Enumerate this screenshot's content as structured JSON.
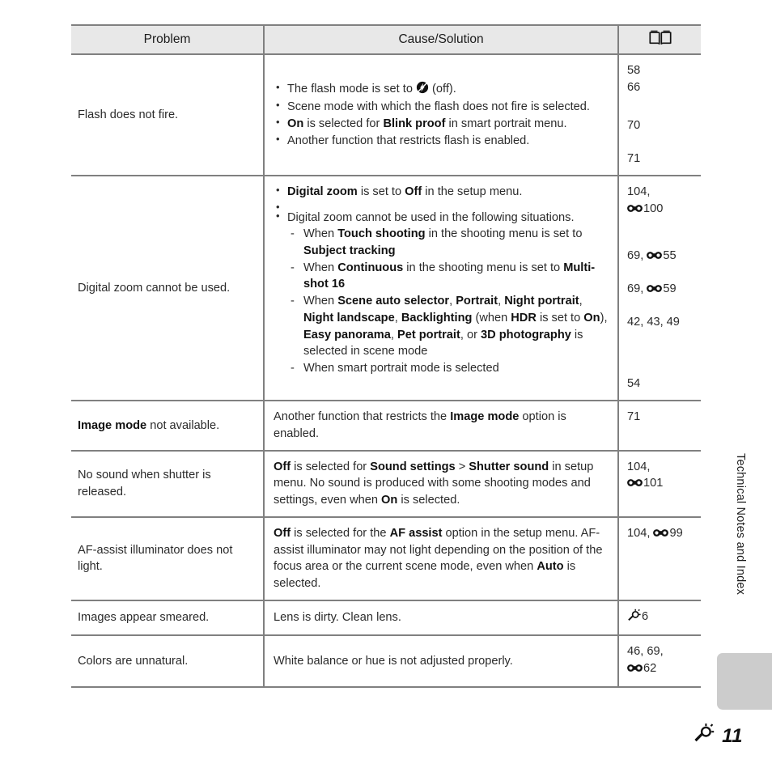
{
  "page": {
    "footer_number": "11",
    "footer_icon": "wrench-icon",
    "side_tab_label": "Technical Notes and Index"
  },
  "table": {
    "headers": {
      "problem": "Problem",
      "cause_solution": "Cause/Solution",
      "reference": "book-icon"
    },
    "rows": [
      {
        "problem": "Flash does not fire.",
        "causes": [
          {
            "text_before": "The flash mode is set to ",
            "icon": "flash-off-icon",
            "text_after": " (off)."
          },
          {
            "text": "Scene mode with which the flash does not fire is selected."
          },
          {
            "bold1": "On",
            "mid1": " is selected for ",
            "bold2": "Blink proof",
            "mid2": " in smart portrait menu."
          },
          {
            "text": "Another function that restricts flash is enabled."
          }
        ],
        "refs": [
          "58",
          "66",
          "70",
          "71"
        ]
      },
      {
        "problem": "Digital zoom cannot be used.",
        "bullet1": {
          "bold1": "Digital zoom",
          "mid1": " is set to ",
          "bold2": "Off",
          "mid2": " in the setup menu."
        },
        "bullet2_intro": "Digital zoom cannot be used in the following situations.",
        "dashes": [
          {
            "pre": "When ",
            "b1": "Touch shooting",
            "mid": " in the shooting menu is set to ",
            "b2": "Subject tracking"
          },
          {
            "pre": "When ",
            "b1": "Continuous",
            "mid": " in the shooting menu is set to ",
            "b2": "Multi-shot 16"
          },
          {
            "pre": "When ",
            "b1": "Scene auto selector",
            "s1": ", ",
            "b2": "Portrait",
            "s2": ", ",
            "b3": "Night portrait",
            "s3": ", ",
            "b4": "Night landscape",
            "s4": ", ",
            "b5": "Backlighting",
            "s5": " (when ",
            "b6": "HDR",
            "s6": " is set to ",
            "b7": "On",
            "s7": "), ",
            "b8": "Easy panorama",
            "s8": ", ",
            "b9": "Pet portrait",
            "s9": ", or ",
            "b10": "3D photography",
            "s10": " is selected in scene mode"
          },
          {
            "plain": "When smart portrait mode is selected"
          }
        ],
        "refs": {
          "r1a": "104,",
          "r1b": "100",
          "r2": "69, ",
          "r2n": "55",
          "r3": "69, ",
          "r3n": "59",
          "r4": "42, 43, 49",
          "r5": "54"
        }
      },
      {
        "problem_bold": "Image mode",
        "problem_rest": " not available.",
        "cause_pre": "Another function that restricts the ",
        "cause_bold": "Image mode",
        "cause_post": " option is enabled.",
        "ref": "71"
      },
      {
        "problem": "No sound when shutter is released.",
        "cause": {
          "b1": "Off",
          "s1": " is selected for ",
          "b2": "Sound settings",
          "s2": " > ",
          "b3": "Shutter sound",
          "s3": " in setup menu. No sound is produced with some shooting modes and settings, even when ",
          "b4": "On",
          "s4": " is selected."
        },
        "ref_line1": "104,",
        "ref_line2": "101"
      },
      {
        "problem": "AF-assist illuminator does not light.",
        "cause": {
          "b1": "Off",
          "s1": " is selected for the ",
          "b2": "AF assist",
          "s2": " option in the setup menu. AF-assist illuminator may not light depending on the position of the focus area or the current scene mode, even when ",
          "b3": "Auto",
          "s3": " is selected."
        },
        "ref_pre": "104, ",
        "ref_num": "99"
      },
      {
        "problem": "Images appear smeared.",
        "cause": "Lens is dirty. Clean lens.",
        "ref_icon": "wrench-icon",
        "ref_num": "6"
      },
      {
        "problem": "Colors are unnatural.",
        "cause": "White balance or hue is not adjusted properly.",
        "ref_line1": "46, 69,",
        "ref_line2": "62"
      }
    ]
  }
}
